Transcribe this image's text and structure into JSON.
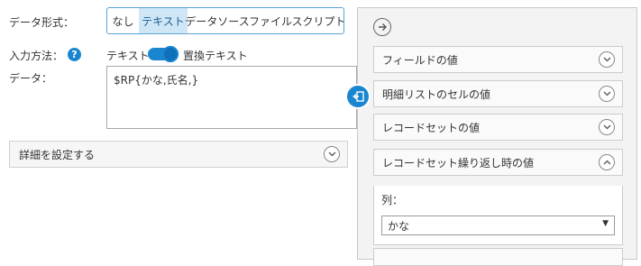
{
  "form": {
    "data_format_label": "データ形式：",
    "format_options": [
      {
        "label": "なし",
        "active": false
      },
      {
        "label": "テキスト",
        "active": true
      },
      {
        "label": "データソース",
        "active": false
      },
      {
        "label": "ファイル",
        "active": false
      },
      {
        "label": "スクリプト",
        "active": false
      }
    ],
    "input_method_label": "入力方法：",
    "help_icon_glyph": "?",
    "toggle_left_label": "テキスト",
    "toggle_right_label": "置換テキスト",
    "toggle_state": "on",
    "data_label": "データ：",
    "data_value": "$RP{かな,氏名,}",
    "details_label": "詳細を設定する"
  },
  "panel": {
    "back_icon": "arrow-right-circle-icon",
    "sections": [
      {
        "label": "フィールドの値",
        "expanded": false
      },
      {
        "label": "明細リストのセルの値",
        "expanded": false
      },
      {
        "label": "レコードセットの値",
        "expanded": false
      },
      {
        "label": "レコードセット繰り返し時の値",
        "expanded": true
      }
    ],
    "column_label": "列：",
    "column_value": "かな"
  },
  "colors": {
    "accent": "#1a86d0",
    "active_tab_bg": "#cfe6f7",
    "panel_bg": "#f3f3f3"
  }
}
